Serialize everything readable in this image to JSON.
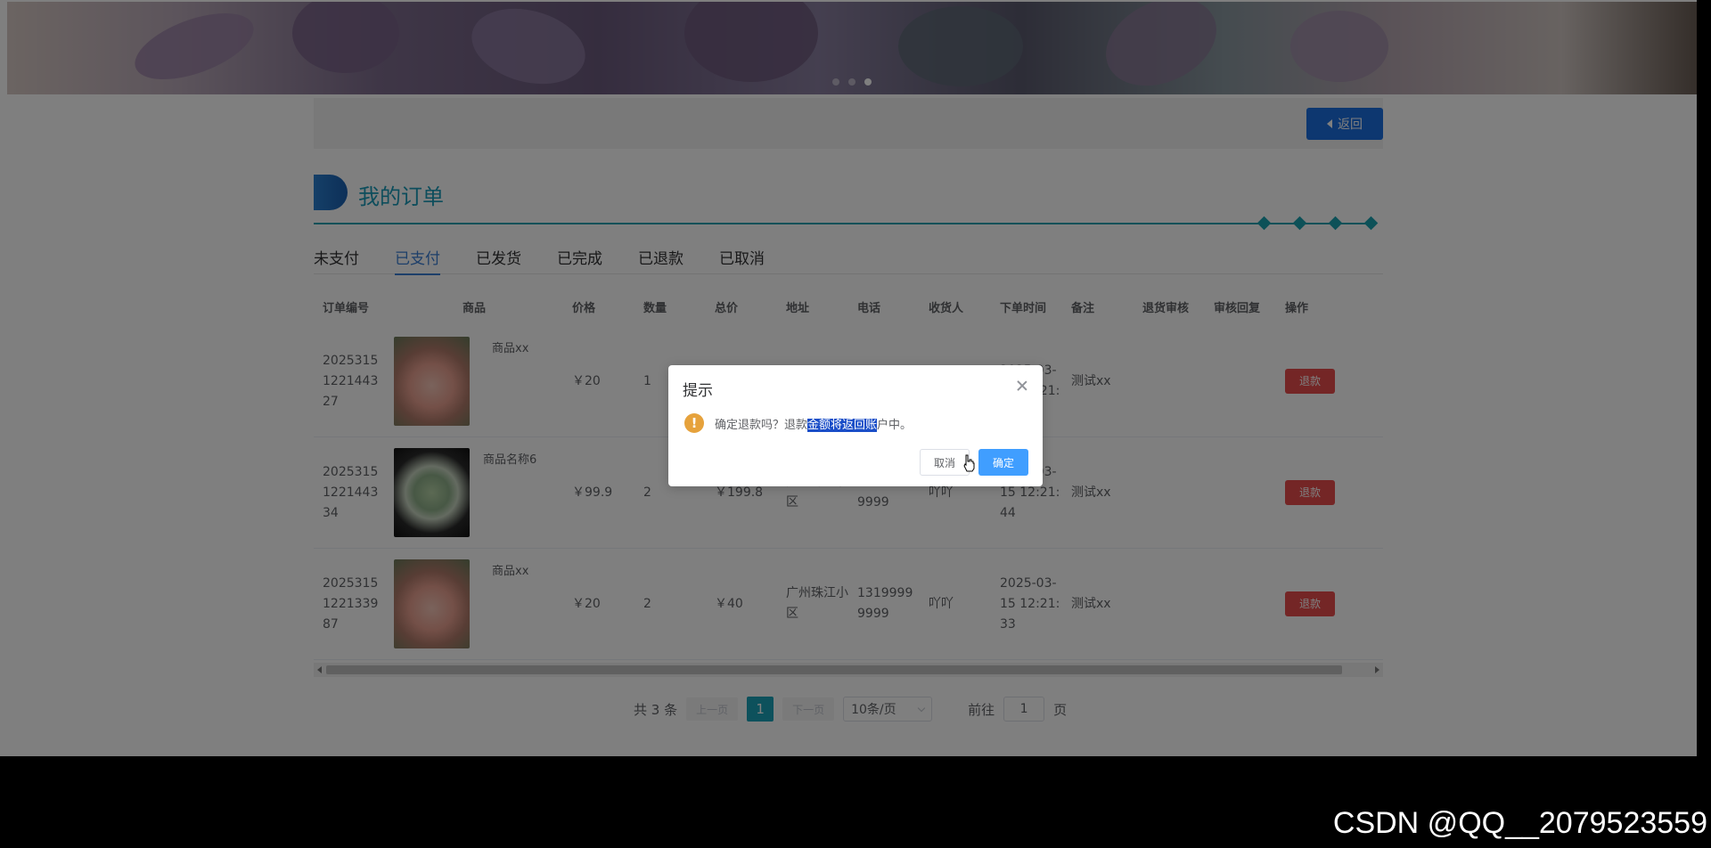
{
  "header": {
    "back_label": "返回"
  },
  "section": {
    "title": "我的订单"
  },
  "tabs": [
    {
      "label": "未支付",
      "active": false
    },
    {
      "label": "已支付",
      "active": true
    },
    {
      "label": "已发货",
      "active": false
    },
    {
      "label": "已完成",
      "active": false
    },
    {
      "label": "已退款",
      "active": false
    },
    {
      "label": "已取消",
      "active": false
    }
  ],
  "table": {
    "columns": [
      "订单编号",
      "商品",
      "价格",
      "数量",
      "总价",
      "地址",
      "电话",
      "收货人",
      "下单时间",
      "备注",
      "退货审核",
      "审核回复",
      "操作"
    ],
    "rows": [
      {
        "id": "2025315122144327",
        "product": "商品xx",
        "price": "￥20",
        "qty": "1",
        "total": "",
        "addr": "",
        "phone": "",
        "name": "",
        "time": "2025-03-15 12:21:",
        "note": "测试xx",
        "action": "退款"
      },
      {
        "id": "2025315122144334",
        "product": "商品名称6",
        "price": "￥99.9",
        "qty": "2",
        "total": "￥199.8",
        "addr": "广州珠江小区",
        "phone": "13199999999",
        "name": "吖吖",
        "time": "2025-03-15 12:21:44",
        "note": "测试xx",
        "action": "退款"
      },
      {
        "id": "2025315122133987",
        "product": "商品xx",
        "price": "￥20",
        "qty": "2",
        "total": "￥40",
        "addr": "广州珠江小区",
        "phone": "13199999999",
        "name": "吖吖",
        "time": "2025-03-15 12:21:33",
        "note": "测试xx",
        "action": "退款"
      }
    ]
  },
  "pagination": {
    "total_text": "共 3 条",
    "prev": "上一页",
    "page": "1",
    "next": "下一页",
    "page_size": "10条/页",
    "goto_label": "前往",
    "goto_value": "1",
    "page_unit": "页"
  },
  "dialog": {
    "title": "提示",
    "message_pre": "确定退款吗？退款",
    "message_highlight": "金额将返回账",
    "message_post": "户中。",
    "cancel": "取消",
    "confirm": "确定"
  },
  "watermark": "CSDN @QQ__2079523559"
}
